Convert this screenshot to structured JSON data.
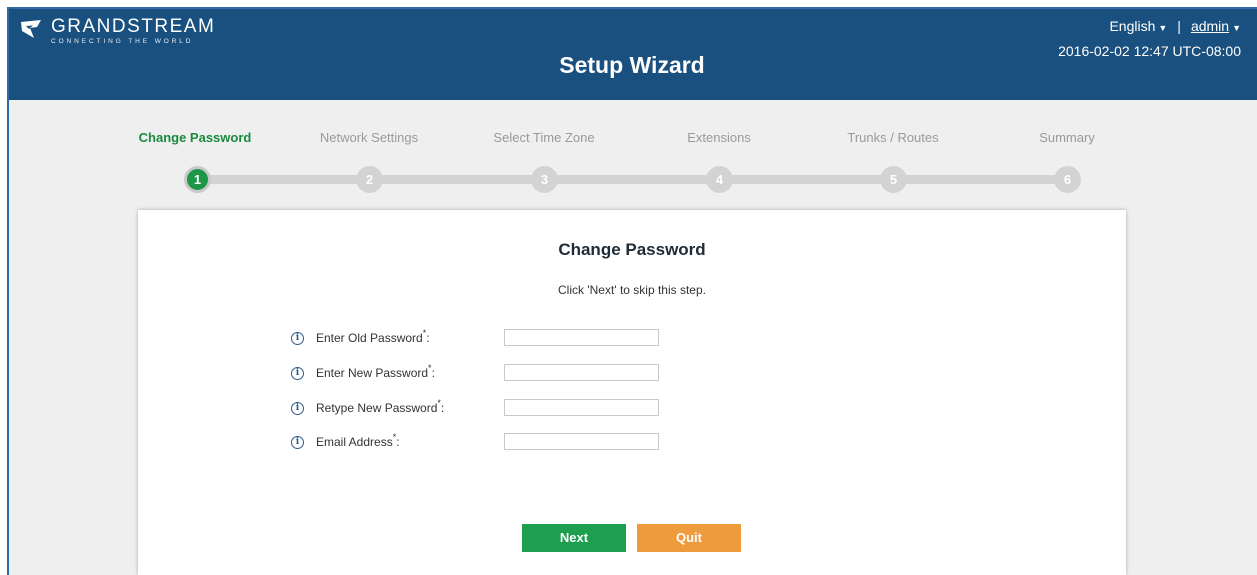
{
  "header": {
    "logo_name": "GRANDSTREAM",
    "logo_tagline": "CONNECTING THE WORLD",
    "title": "Setup Wizard",
    "language": "English",
    "separator": "|",
    "user": "admin",
    "datetime": "2016-02-02 12:47 UTC-08:00"
  },
  "steps": [
    {
      "label": "Change Password",
      "number": "1",
      "active": true
    },
    {
      "label": "Network Settings",
      "number": "2",
      "active": false
    },
    {
      "label": "Select Time Zone",
      "number": "3",
      "active": false
    },
    {
      "label": "Extensions",
      "number": "4",
      "active": false
    },
    {
      "label": "Trunks / Routes",
      "number": "5",
      "active": false
    },
    {
      "label": "Summary",
      "number": "6",
      "active": false
    }
  ],
  "panel": {
    "title": "Change Password",
    "subtitle": "Click 'Next' to skip this step.",
    "fields": [
      {
        "label": "Enter Old Password",
        "required_mark": "*",
        "suffix": ":",
        "value": ""
      },
      {
        "label": "Enter New Password",
        "required_mark": "*",
        "suffix": ":",
        "value": ""
      },
      {
        "label": "Retype New Password",
        "required_mark": "*",
        "suffix": ":",
        "value": ""
      },
      {
        "label": "Email Address",
        "required_mark": "*",
        "suffix": ":",
        "value": ""
      }
    ],
    "next_label": "Next",
    "quit_label": "Quit"
  },
  "colors": {
    "header_bg": "#1a507f",
    "active_step": "#1a8a3e",
    "next_button": "#1e9e4f",
    "quit_button": "#ee9b3d"
  }
}
